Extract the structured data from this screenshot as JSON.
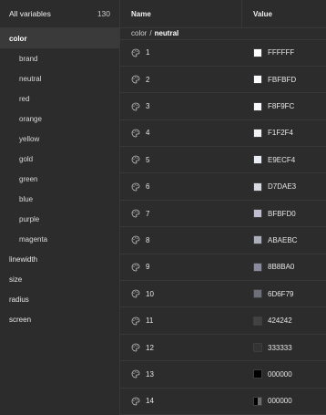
{
  "sidebar": {
    "title": "All variables",
    "count": "130",
    "items": [
      {
        "label": "color",
        "active": true
      },
      {
        "label": "brand",
        "child": true
      },
      {
        "label": "neutral",
        "child": true
      },
      {
        "label": "red",
        "child": true
      },
      {
        "label": "orange",
        "child": true
      },
      {
        "label": "yellow",
        "child": true
      },
      {
        "label": "gold",
        "child": true
      },
      {
        "label": "green",
        "child": true
      },
      {
        "label": "blue",
        "child": true
      },
      {
        "label": "purple",
        "child": true
      },
      {
        "label": "magenta",
        "child": true
      },
      {
        "label": "linewidth"
      },
      {
        "label": "size"
      },
      {
        "label": "radius"
      },
      {
        "label": "screen"
      }
    ]
  },
  "table": {
    "name_header": "Name",
    "value_header": "Value",
    "breadcrumb_parent": "color",
    "breadcrumb_sep": "/",
    "breadcrumb_current": "neutral",
    "rows": [
      {
        "name": "1",
        "hex": "FFFFFF",
        "color": "#FFFFFF"
      },
      {
        "name": "2",
        "hex": "FBFBFD",
        "color": "#FBFBFD"
      },
      {
        "name": "3",
        "hex": "F8F9FC",
        "color": "#F8F9FC"
      },
      {
        "name": "4",
        "hex": "F1F2F4",
        "color": "#F1F2F4"
      },
      {
        "name": "5",
        "hex": "E9ECF4",
        "color": "#E9ECF4"
      },
      {
        "name": "6",
        "hex": "D7DAE3",
        "color": "#D7DAE3"
      },
      {
        "name": "7",
        "hex": "BFBFD0",
        "color": "#BFBFD0"
      },
      {
        "name": "8",
        "hex": "ABAEBC",
        "color": "#ABAEBC"
      },
      {
        "name": "9",
        "hex": "8B8BA0",
        "color": "#8B8BA0"
      },
      {
        "name": "10",
        "hex": "6D6F79",
        "color": "#6D6F79"
      },
      {
        "name": "11",
        "hex": "424242",
        "color": "#424242"
      },
      {
        "name": "12",
        "hex": "333333",
        "color": "#333333"
      },
      {
        "name": "13",
        "hex": "000000",
        "color": "#000000"
      },
      {
        "name": "14",
        "hex": "000000",
        "color": "#000000",
        "split": true
      }
    ],
    "row_icon": "palette-icon"
  }
}
